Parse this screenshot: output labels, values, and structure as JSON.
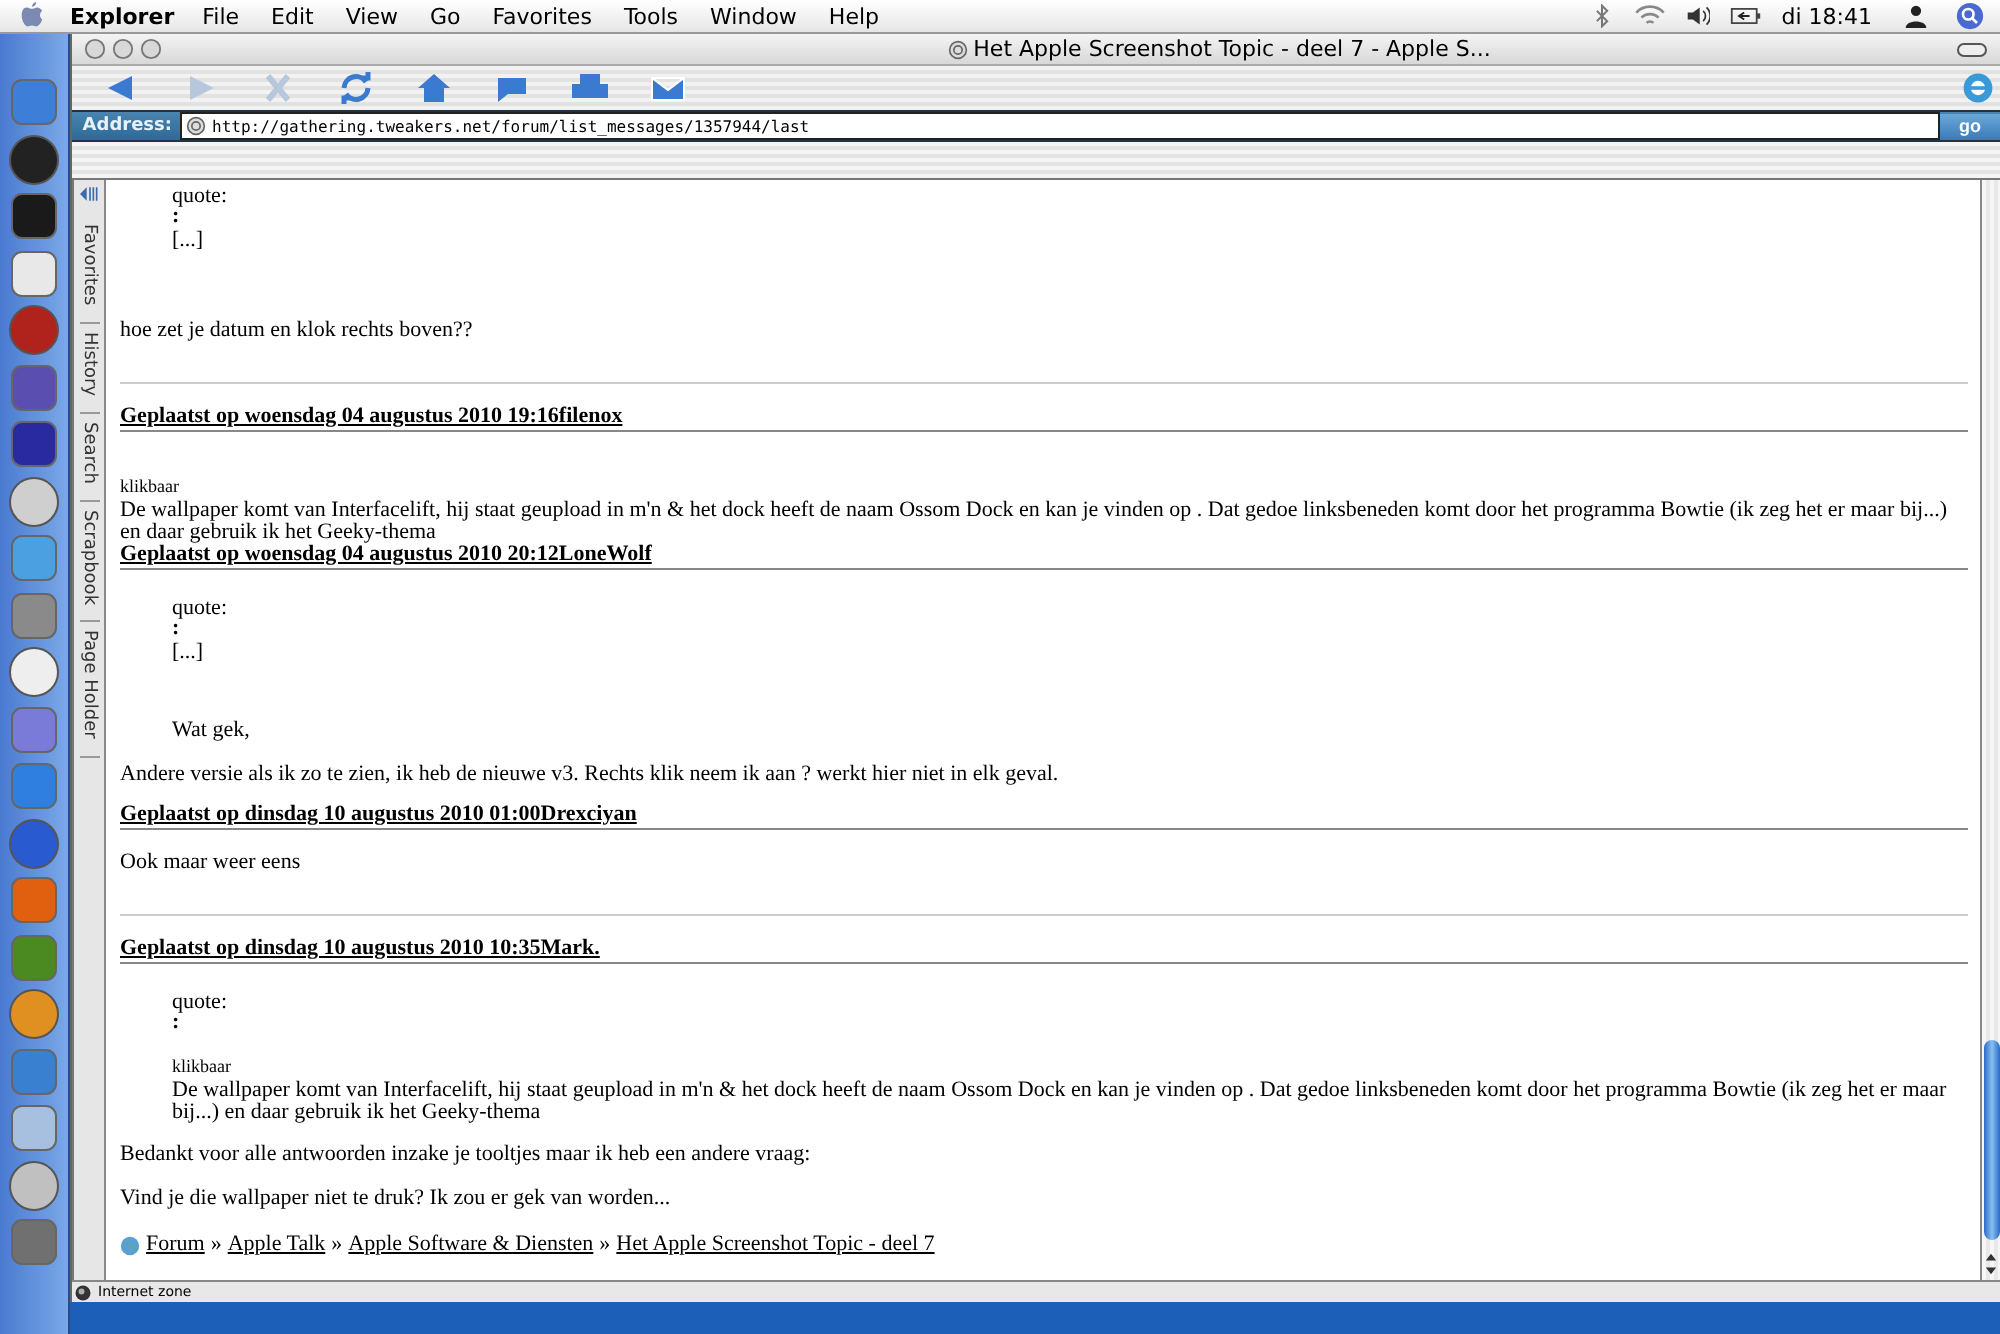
{
  "menu_bar": {
    "app": "Explorer",
    "items": [
      "File",
      "Edit",
      "View",
      "Go",
      "Favorites",
      "Tools",
      "Window",
      "Help"
    ],
    "clock": "di 18:41"
  },
  "window": {
    "title": "Het Apple Screenshot Topic - deel 7 - Apple S...",
    "address_label": "Address:",
    "url": "http://gathering.tweakers.net/forum/list_messages/1357944/last",
    "go": "go"
  },
  "toolbar": [
    {
      "kind": "back",
      "disabled": false
    },
    {
      "kind": "forward",
      "disabled": true
    },
    {
      "kind": "stop",
      "disabled": true
    },
    {
      "kind": "refresh",
      "disabled": false
    },
    {
      "kind": "home",
      "disabled": false
    },
    {
      "kind": "chat",
      "disabled": false
    },
    {
      "kind": "print",
      "disabled": false
    },
    {
      "kind": "mail",
      "disabled": false
    }
  ],
  "explorer_tabs": [
    "Favorites",
    "History",
    "Search",
    "Scrapbook",
    "Page Holder"
  ],
  "blocks": [
    {
      "kind": "quote",
      "label": "quote:",
      "colon": ":",
      "ellipsis": "[...]"
    },
    {
      "kind": "text",
      "text": "hoe zet je datum en klok rechts boven??",
      "indented": false
    },
    {
      "kind": "rule"
    },
    {
      "kind": "heading",
      "text": "Geplaatst op woensdag 04 augustus 2010 19:16filenox"
    },
    {
      "kind": "small",
      "text": "klikbaar",
      "indented": false
    },
    {
      "kind": "para",
      "text": "De wallpaper komt van Interfacelift, hij staat geupload in m'n  & het dock heeft de naam Ossom Dock en kan je vinden op . Dat gedoe linksbeneden komt door het programma Bowtie (ik zeg het er maar bij...) en daar gebruik ik het Geeky-thema",
      "indented": false
    },
    {
      "kind": "heading",
      "text": "Geplaatst op woensdag 04 augustus 2010 20:12LoneWolf"
    },
    {
      "kind": "quote",
      "label": "quote:",
      "colon": ":",
      "ellipsis": "[...]"
    },
    {
      "kind": "text",
      "text": "Wat gek,",
      "indented": true
    },
    {
      "kind": "text",
      "text": "Andere versie als ik zo te zien, ik heb de nieuwe v3. Rechts klik neem ik aan ? werkt hier niet in elk geval.",
      "indented": false
    },
    {
      "kind": "heading",
      "text": "Geplaatst op dinsdag 10 augustus 2010 01:00Drexciyan"
    },
    {
      "kind": "text",
      "text": "Ook maar weer eens",
      "indented": false
    },
    {
      "kind": "rule"
    },
    {
      "kind": "heading",
      "text": "Geplaatst op dinsdag 10 augustus 2010 10:35Mark."
    },
    {
      "kind": "quote",
      "label": "quote:",
      "colon": ":"
    },
    {
      "kind": "small",
      "text": "klikbaar",
      "indented": true
    },
    {
      "kind": "para",
      "text": "De wallpaper komt van Interfacelift, hij staat geupload in m'n  & het dock heeft de naam Ossom Dock en kan je vinden op . Dat gedoe linksbeneden komt door het programma Bowtie (ik zeg het er maar bij...) en daar gebruik ik het Geeky-thema",
      "indented": true
    },
    {
      "kind": "text",
      "text": "Bedankt voor alle antwoorden inzake je tooltjes maar ik heb een andere vraag:",
      "indented": false
    },
    {
      "kind": "text",
      "text": "Vind je die wallpaper niet te druk? Ik zou er gek van worden...",
      "indented": false
    }
  ],
  "breadcrumb": {
    "links": [
      "Forum",
      "Apple Talk",
      "Apple Software & Diensten",
      "Het Apple Screenshot Topic - deel 7"
    ],
    "separator": "»"
  },
  "status_bar": "Internet zone"
}
